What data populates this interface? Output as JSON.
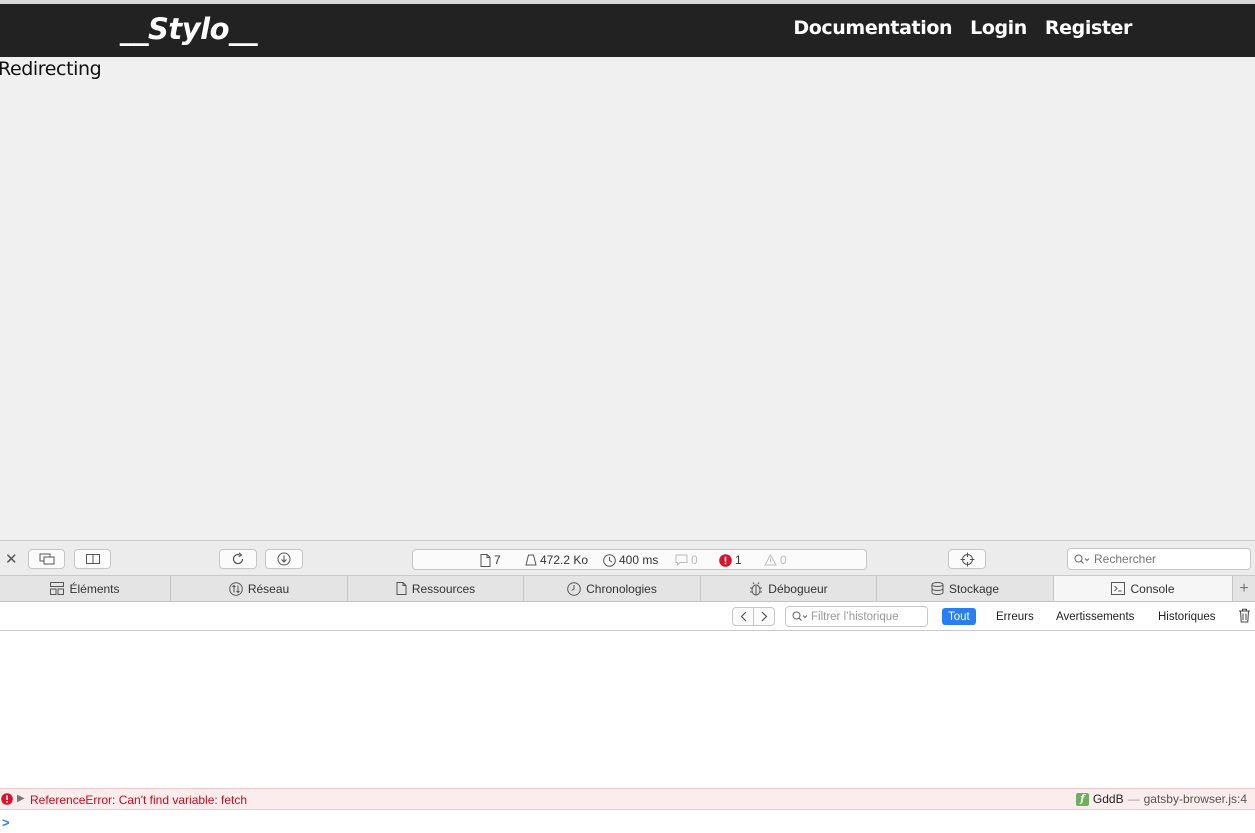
{
  "navbar": {
    "logo": "__Stylo__",
    "links": [
      "Documentation",
      "Login",
      "Register"
    ]
  },
  "page": {
    "message": "Redirecting"
  },
  "devtools": {
    "status": {
      "resources": "7",
      "size": "472.2 Ko",
      "time": "400 ms",
      "logs": "0",
      "errors": "1",
      "warnings": "0"
    },
    "search_placeholder": "Rechercher",
    "tabs": [
      {
        "label": "Éléments",
        "icon": "elements-icon"
      },
      {
        "label": "Réseau",
        "icon": "network-icon"
      },
      {
        "label": "Ressources",
        "icon": "resources-icon"
      },
      {
        "label": "Chronologies",
        "icon": "timelines-icon"
      },
      {
        "label": "Débogueur",
        "icon": "debugger-icon"
      },
      {
        "label": "Stockage",
        "icon": "storage-icon"
      },
      {
        "label": "Console",
        "icon": "console-icon"
      }
    ],
    "active_tab": "Console",
    "filter_placeholder": "Filtrer l’historique",
    "levels": [
      "Tout",
      "Erreurs",
      "Avertissements",
      "Historiques"
    ],
    "active_level": "Tout",
    "messages": [
      {
        "type": "error",
        "text": "ReferenceError: Can't find variable: fetch",
        "function": "GddB",
        "separator": "—",
        "source": "gatsby-browser.js:4"
      }
    ],
    "prompt": ">"
  },
  "colors": {
    "navbar_bg": "#222222",
    "page_bg": "#f0f0f0",
    "accent": "#2a7ef3",
    "error": "#c40d1e",
    "error_row_bg": "#fdeced"
  }
}
